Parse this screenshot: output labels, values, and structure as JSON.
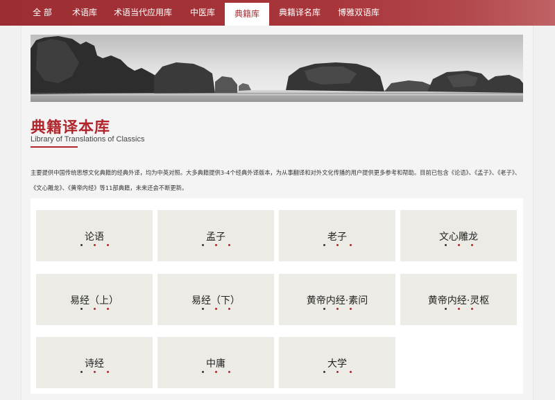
{
  "nav": {
    "tabs": [
      {
        "label": "全 部",
        "active": false
      },
      {
        "label": "术语库",
        "active": false
      },
      {
        "label": "术语当代应用库",
        "active": false
      },
      {
        "label": "中医库",
        "active": false
      },
      {
        "label": "典籍库",
        "active": true
      },
      {
        "label": "典籍译名库",
        "active": false
      },
      {
        "label": "博雅双语库",
        "active": false
      }
    ]
  },
  "header": {
    "title_cn": "典籍译本库",
    "title_en": "Library of Translations of Classics"
  },
  "description": "主要提供中国传统思想文化典籍的经典外译，均为中英对照。大多典籍提供3-4个经典外译版本，为从事翻译和对外文化传播的用户提供更多参考和帮助。目前已包含《论语》、《孟子》、《老子》、《文心雕龙》、《黄帝内经》等11部典籍，未来还会不断更新。",
  "books": [
    {
      "label": "论语"
    },
    {
      "label": "孟子"
    },
    {
      "label": "老子"
    },
    {
      "label": "文心雕龙"
    },
    {
      "label": "易经（上）"
    },
    {
      "label": "易经（下）"
    },
    {
      "label": "黄帝内经·素问"
    },
    {
      "label": "黄帝内经·灵枢"
    },
    {
      "label": "诗经"
    },
    {
      "label": "中庸"
    },
    {
      "label": "大学"
    }
  ],
  "colors": {
    "brand_red": "#a33036",
    "dot_colors": [
      "#333333",
      "#b0262c",
      "#b0262c"
    ]
  }
}
